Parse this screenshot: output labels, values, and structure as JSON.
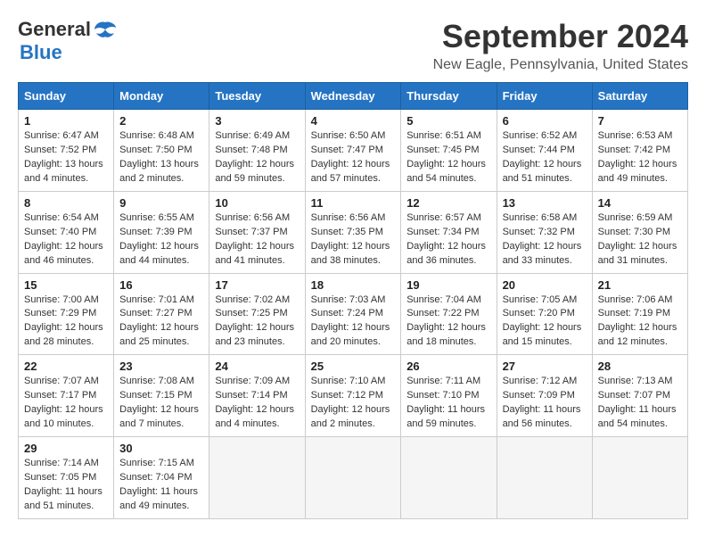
{
  "logo": {
    "line1": "General",
    "line2": "Blue"
  },
  "title": "September 2024",
  "location": "New Eagle, Pennsylvania, United States",
  "days_of_week": [
    "Sunday",
    "Monday",
    "Tuesday",
    "Wednesday",
    "Thursday",
    "Friday",
    "Saturday"
  ],
  "weeks": [
    [
      {
        "day": 1,
        "info": "Sunrise: 6:47 AM\nSunset: 7:52 PM\nDaylight: 13 hours\nand 4 minutes."
      },
      {
        "day": 2,
        "info": "Sunrise: 6:48 AM\nSunset: 7:50 PM\nDaylight: 13 hours\nand 2 minutes."
      },
      {
        "day": 3,
        "info": "Sunrise: 6:49 AM\nSunset: 7:48 PM\nDaylight: 12 hours\nand 59 minutes."
      },
      {
        "day": 4,
        "info": "Sunrise: 6:50 AM\nSunset: 7:47 PM\nDaylight: 12 hours\nand 57 minutes."
      },
      {
        "day": 5,
        "info": "Sunrise: 6:51 AM\nSunset: 7:45 PM\nDaylight: 12 hours\nand 54 minutes."
      },
      {
        "day": 6,
        "info": "Sunrise: 6:52 AM\nSunset: 7:44 PM\nDaylight: 12 hours\nand 51 minutes."
      },
      {
        "day": 7,
        "info": "Sunrise: 6:53 AM\nSunset: 7:42 PM\nDaylight: 12 hours\nand 49 minutes."
      }
    ],
    [
      {
        "day": 8,
        "info": "Sunrise: 6:54 AM\nSunset: 7:40 PM\nDaylight: 12 hours\nand 46 minutes."
      },
      {
        "day": 9,
        "info": "Sunrise: 6:55 AM\nSunset: 7:39 PM\nDaylight: 12 hours\nand 44 minutes."
      },
      {
        "day": 10,
        "info": "Sunrise: 6:56 AM\nSunset: 7:37 PM\nDaylight: 12 hours\nand 41 minutes."
      },
      {
        "day": 11,
        "info": "Sunrise: 6:56 AM\nSunset: 7:35 PM\nDaylight: 12 hours\nand 38 minutes."
      },
      {
        "day": 12,
        "info": "Sunrise: 6:57 AM\nSunset: 7:34 PM\nDaylight: 12 hours\nand 36 minutes."
      },
      {
        "day": 13,
        "info": "Sunrise: 6:58 AM\nSunset: 7:32 PM\nDaylight: 12 hours\nand 33 minutes."
      },
      {
        "day": 14,
        "info": "Sunrise: 6:59 AM\nSunset: 7:30 PM\nDaylight: 12 hours\nand 31 minutes."
      }
    ],
    [
      {
        "day": 15,
        "info": "Sunrise: 7:00 AM\nSunset: 7:29 PM\nDaylight: 12 hours\nand 28 minutes."
      },
      {
        "day": 16,
        "info": "Sunrise: 7:01 AM\nSunset: 7:27 PM\nDaylight: 12 hours\nand 25 minutes."
      },
      {
        "day": 17,
        "info": "Sunrise: 7:02 AM\nSunset: 7:25 PM\nDaylight: 12 hours\nand 23 minutes."
      },
      {
        "day": 18,
        "info": "Sunrise: 7:03 AM\nSunset: 7:24 PM\nDaylight: 12 hours\nand 20 minutes."
      },
      {
        "day": 19,
        "info": "Sunrise: 7:04 AM\nSunset: 7:22 PM\nDaylight: 12 hours\nand 18 minutes."
      },
      {
        "day": 20,
        "info": "Sunrise: 7:05 AM\nSunset: 7:20 PM\nDaylight: 12 hours\nand 15 minutes."
      },
      {
        "day": 21,
        "info": "Sunrise: 7:06 AM\nSunset: 7:19 PM\nDaylight: 12 hours\nand 12 minutes."
      }
    ],
    [
      {
        "day": 22,
        "info": "Sunrise: 7:07 AM\nSunset: 7:17 PM\nDaylight: 12 hours\nand 10 minutes."
      },
      {
        "day": 23,
        "info": "Sunrise: 7:08 AM\nSunset: 7:15 PM\nDaylight: 12 hours\nand 7 minutes."
      },
      {
        "day": 24,
        "info": "Sunrise: 7:09 AM\nSunset: 7:14 PM\nDaylight: 12 hours\nand 4 minutes."
      },
      {
        "day": 25,
        "info": "Sunrise: 7:10 AM\nSunset: 7:12 PM\nDaylight: 12 hours\nand 2 minutes."
      },
      {
        "day": 26,
        "info": "Sunrise: 7:11 AM\nSunset: 7:10 PM\nDaylight: 11 hours\nand 59 minutes."
      },
      {
        "day": 27,
        "info": "Sunrise: 7:12 AM\nSunset: 7:09 PM\nDaylight: 11 hours\nand 56 minutes."
      },
      {
        "day": 28,
        "info": "Sunrise: 7:13 AM\nSunset: 7:07 PM\nDaylight: 11 hours\nand 54 minutes."
      }
    ],
    [
      {
        "day": 29,
        "info": "Sunrise: 7:14 AM\nSunset: 7:05 PM\nDaylight: 11 hours\nand 51 minutes."
      },
      {
        "day": 30,
        "info": "Sunrise: 7:15 AM\nSunset: 7:04 PM\nDaylight: 11 hours\nand 49 minutes."
      },
      {
        "day": null,
        "info": ""
      },
      {
        "day": null,
        "info": ""
      },
      {
        "day": null,
        "info": ""
      },
      {
        "day": null,
        "info": ""
      },
      {
        "day": null,
        "info": ""
      }
    ]
  ]
}
